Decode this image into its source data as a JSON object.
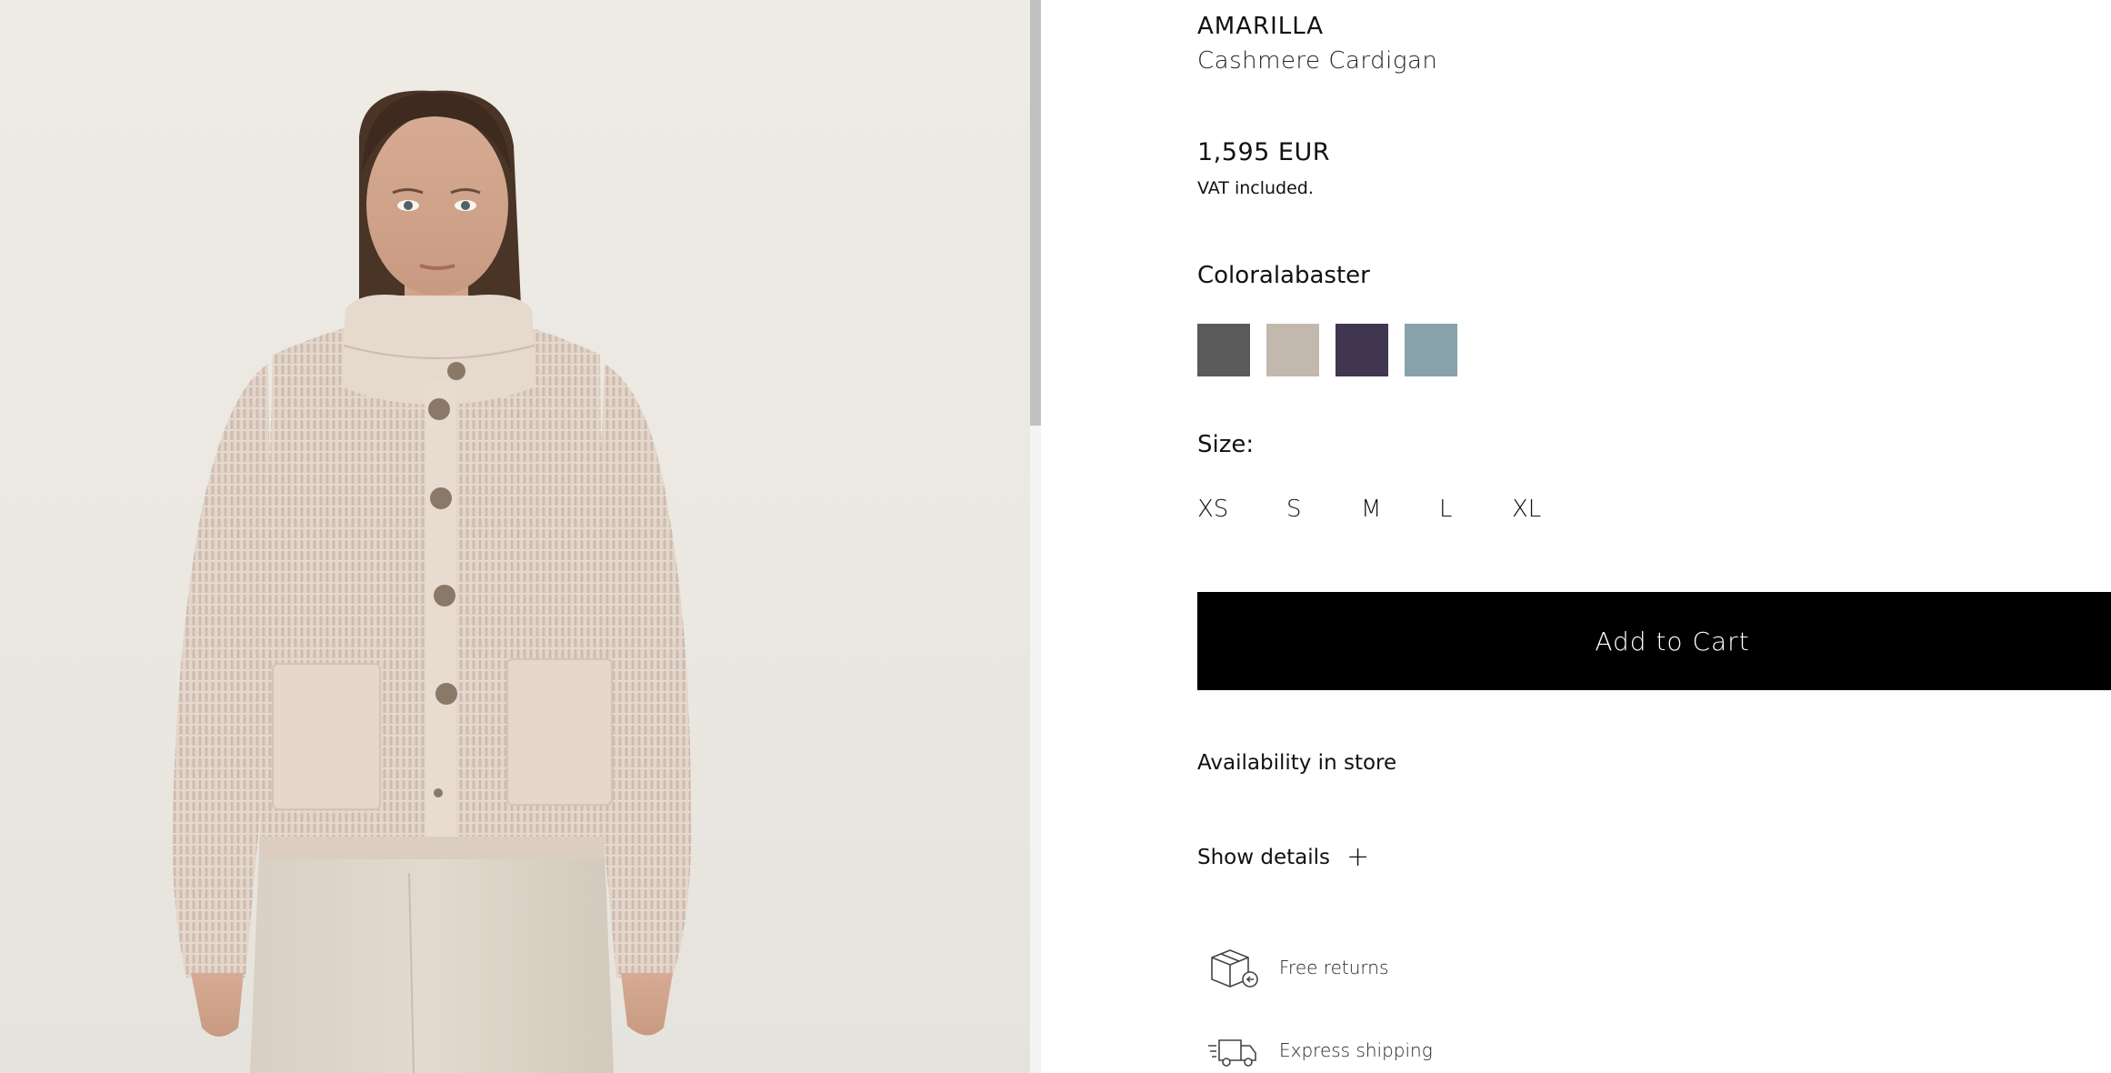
{
  "product": {
    "brand": "AMARILLA",
    "name": "Cashmere Cardigan",
    "price": "1,595 EUR",
    "vat_note": "VAT included.",
    "color_label": "Coloralabaster",
    "swatches": [
      {
        "name": "dark-grey",
        "hex": "#5a5a5a"
      },
      {
        "name": "alabaster",
        "hex": "#c3b8ae"
      },
      {
        "name": "aubergine",
        "hex": "#403650"
      },
      {
        "name": "blue-grey",
        "hex": "#87a2ab"
      }
    ],
    "size_label": "Size:",
    "sizes": [
      "XS",
      "S",
      "M",
      "L",
      "XL"
    ],
    "add_to_cart": "Add to Cart",
    "availability": "Availability in store",
    "show_details": "Show details",
    "show_details_icon": "plus-icon"
  },
  "services": [
    {
      "label": "Free returns",
      "icon": "box-return-icon"
    },
    {
      "label": "Express shipping",
      "icon": "delivery-truck-icon"
    }
  ],
  "colors": {
    "button_bg": "#000000",
    "button_text": "#ffffff",
    "photo_bg": "#ece9e3"
  }
}
